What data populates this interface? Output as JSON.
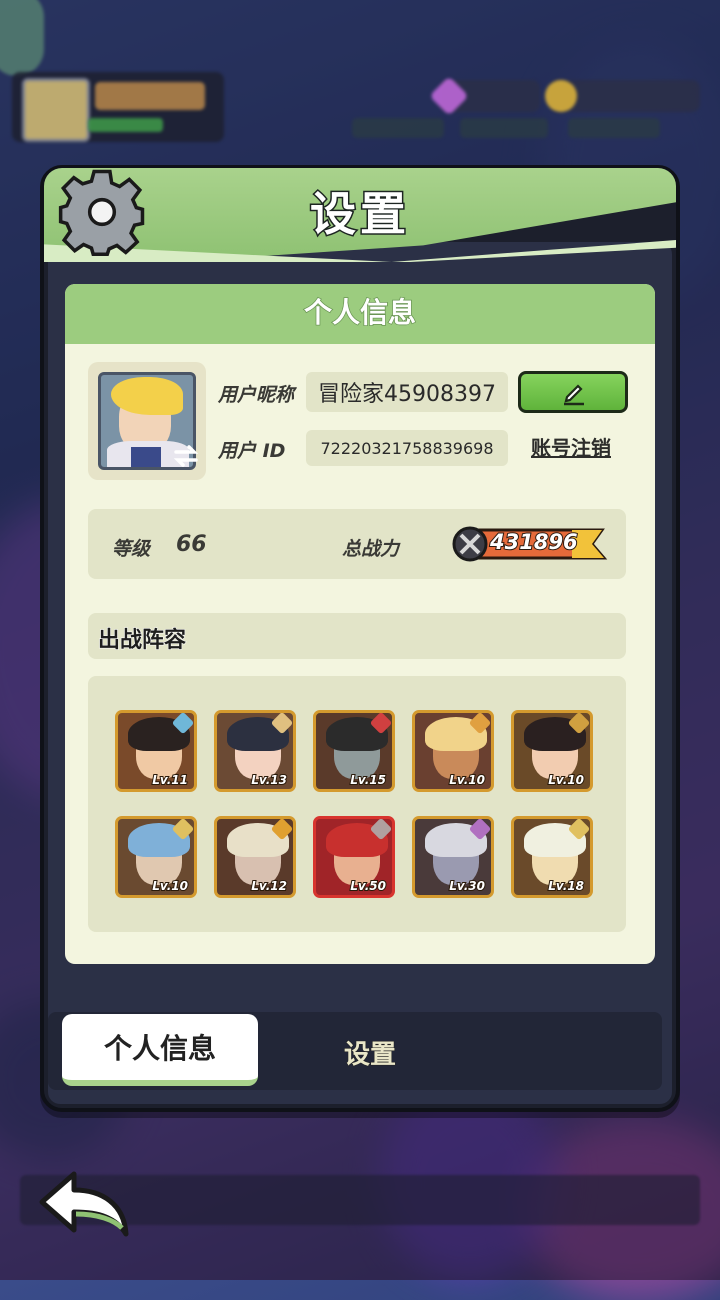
{
  "colors": {
    "accent_green": "#9ccc7f",
    "card_bg": "#f3f5df",
    "power_orange": "#e56a3a"
  },
  "header": {
    "title": "设置",
    "icon": "gear-icon"
  },
  "profile": {
    "section_title": "个人信息",
    "nickname_label": "用户昵称",
    "nickname_value": "冒险家45908397",
    "id_label": "用户 ID",
    "id_value": "72220321758839698",
    "edit_icon": "pencil-icon",
    "logout_label": "账号注销",
    "level_label": "等级",
    "level_value": "66",
    "power_label": "总战力",
    "power_value": "431896"
  },
  "team": {
    "title": "出战阵容",
    "heroes": [
      {
        "level": "Lv.11",
        "bg": "#7a4a2a",
        "hair": "#2a2220",
        "skin": "#f0c9a4",
        "badge": "#6fb7d8"
      },
      {
        "level": "Lv.13",
        "bg": "#6b4a34",
        "hair": "#2c3040",
        "skin": "#f3d2c0",
        "badge": "#e0c080"
      },
      {
        "level": "Lv.15",
        "bg": "#5a3a2a",
        "hair": "#2b2b2b",
        "skin": "#8f9a9a",
        "badge": "#d04040"
      },
      {
        "level": "Lv.10",
        "bg": "#6a4030",
        "hair": "#f1d38a",
        "skin": "#c98a5a",
        "badge": "#e0a040"
      },
      {
        "level": "Lv.10",
        "bg": "#6a4a28",
        "hair": "#2a2020",
        "skin": "#f2ccb0",
        "badge": "#d0a040"
      },
      {
        "level": "Lv.10",
        "bg": "#6a4a30",
        "hair": "#7fb0d8",
        "skin": "#e0c8b0",
        "badge": "#e0c060"
      },
      {
        "level": "Lv.12",
        "bg": "#5a3a2a",
        "hair": "#e8e0c8",
        "skin": "#d8c0b0",
        "badge": "#e0a030"
      },
      {
        "level": "Lv.50",
        "bg": "#a02428",
        "hair": "#c8302e",
        "skin": "#e8b090",
        "badge": "#b0a0a0"
      },
      {
        "level": "Lv.30",
        "bg": "#4a3a3a",
        "hair": "#d8d8e0",
        "skin": "#9a9ab0",
        "badge": "#b070c0"
      },
      {
        "level": "Lv.18",
        "bg": "#6a4a2a",
        "hair": "#f0f0e0",
        "skin": "#f0dcb0",
        "badge": "#e0c060"
      }
    ]
  },
  "tabs": {
    "active": "个人信息",
    "inactive": "设置"
  },
  "nav": {
    "back_icon": "back-arrow-icon"
  }
}
